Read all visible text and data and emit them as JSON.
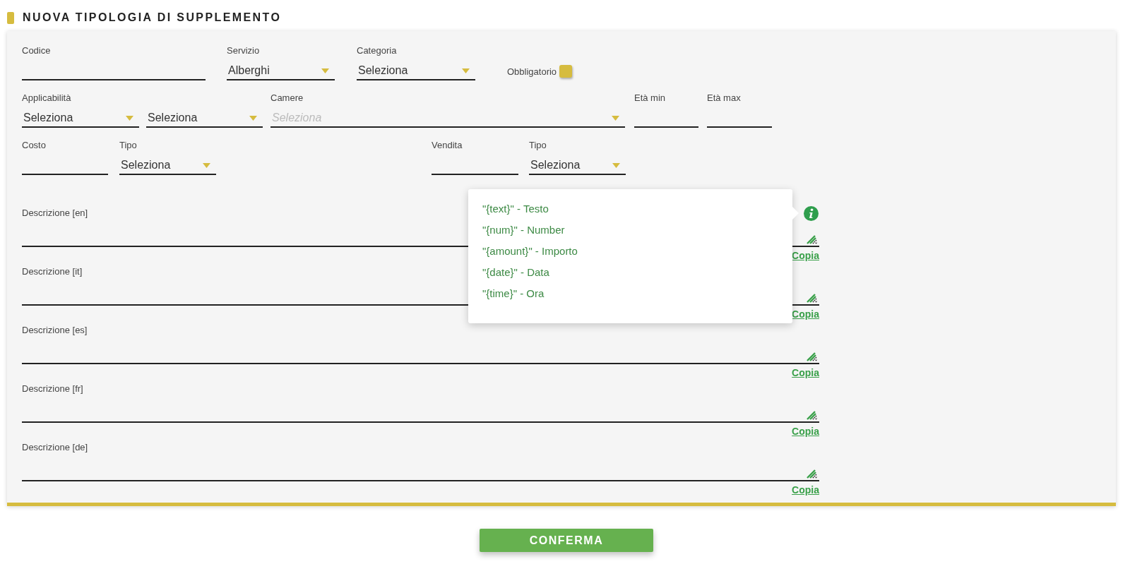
{
  "title": "NUOVA TIPOLOGIA DI SUPPLEMENTO",
  "rows": [
    [
      {
        "kind": "text",
        "label": "Codice"
      },
      {
        "kind": "select",
        "label": "Servizio",
        "value": "Alberghi"
      },
      {
        "kind": "select",
        "label": "Categoria",
        "value": "Seleziona"
      },
      {
        "kind": "checkbox",
        "label": "Obbligatorio",
        "checked": false
      }
    ],
    [
      {
        "kind": "select",
        "label": "Applicabilità",
        "value": "Seleziona"
      },
      {
        "kind": "select",
        "value": "Seleziona"
      },
      {
        "kind": "select",
        "label": "Camere",
        "placeholder": "Seleziona"
      },
      {
        "kind": "text",
        "label": "Età min"
      },
      {
        "kind": "text",
        "label": "Età max"
      }
    ],
    [
      {
        "kind": "text",
        "label": "Costo"
      },
      {
        "kind": "select",
        "label": "Tipo",
        "value": "Seleziona"
      },
      {
        "kind": "text",
        "label": "Vendita"
      },
      {
        "kind": "select",
        "label": "Tipo",
        "value": "Seleziona"
      }
    ]
  ],
  "descriptions": [
    {
      "label": "Descrizione [en]",
      "action": "Copia"
    },
    {
      "label": "Descrizione [it]",
      "action": "Copia"
    },
    {
      "label": "Descrizione [es]",
      "action": "Copia"
    },
    {
      "label": "Descrizione [fr]",
      "action": "Copia"
    },
    {
      "label": "Descrizione [de]",
      "action": "Copia"
    }
  ],
  "hint_popover": {
    "items": [
      "\"{text}\" - Testo",
      "\"{num}\" - Number",
      "\"{amount}\" - Importo",
      "\"{date}\" - Data",
      "\"{time}\" - Ora"
    ]
  },
  "confirm_button": "CONFERMA"
}
